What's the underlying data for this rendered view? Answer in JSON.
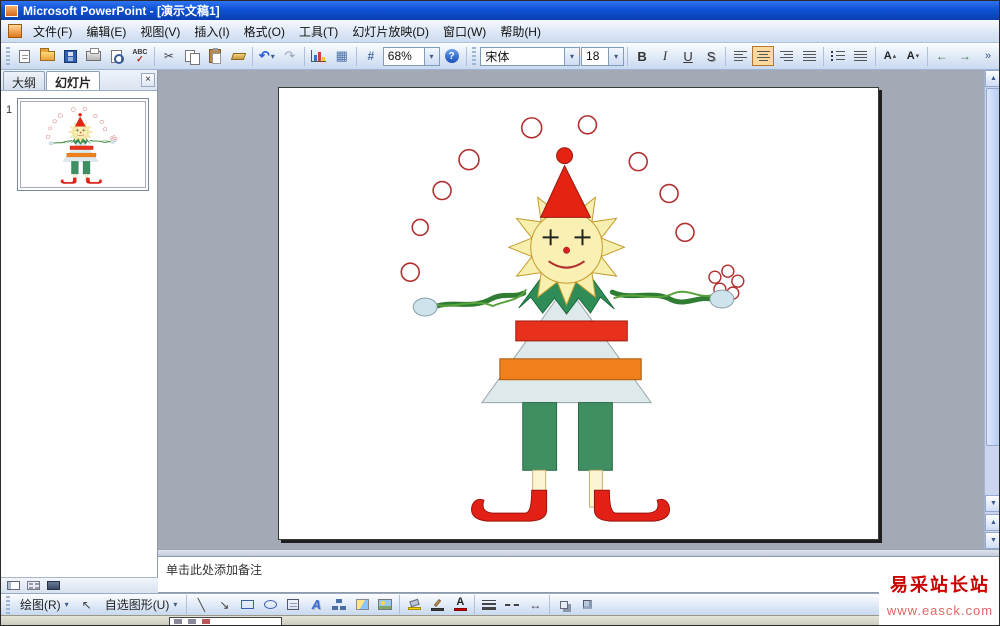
{
  "titlebar": {
    "title": "Microsoft PowerPoint - [演示文稿1]"
  },
  "menubar": {
    "items": [
      {
        "label": "文件(F)"
      },
      {
        "label": "编辑(E)"
      },
      {
        "label": "视图(V)"
      },
      {
        "label": "插入(I)"
      },
      {
        "label": "格式(O)"
      },
      {
        "label": "工具(T)"
      },
      {
        "label": "幻灯片放映(D)"
      },
      {
        "label": "窗口(W)"
      },
      {
        "label": "帮助(H)"
      }
    ]
  },
  "standard_toolbar": {
    "zoom_value": "68%"
  },
  "formatting_toolbar": {
    "font_name": "宋体",
    "font_size": "18",
    "bold_label": "B",
    "italic_label": "I",
    "underline_label": "U",
    "shadow_label": "S"
  },
  "slides_panel": {
    "outline_tab": "大纲",
    "slides_tab": "幻灯片",
    "slide_number": "1"
  },
  "notes_pane": {
    "placeholder": "单击此处添加备注"
  },
  "drawing_toolbar": {
    "draw_label": "绘图(R)",
    "autoshapes_label": "自选图形(U)"
  },
  "watermark": {
    "title": "易采站长站",
    "url": "www.easck.com"
  },
  "icons": {
    "caret": "▾",
    "close": "×",
    "cut": "✂",
    "undo": "↶",
    "redo": "↷",
    "table": "▦",
    "grid": "#",
    "help": "?",
    "spell_abc": "ABC",
    "check": "✓",
    "pointer": "↖",
    "line": "╲",
    "arrow": "↘",
    "arrow_style": "↔",
    "letter_a": "A",
    "tri_up": "▴",
    "tri_down": "▾",
    "promote": "←",
    "demote": "→",
    "more": "»",
    "up_arrow": "▲",
    "down_arrow": "▼"
  }
}
